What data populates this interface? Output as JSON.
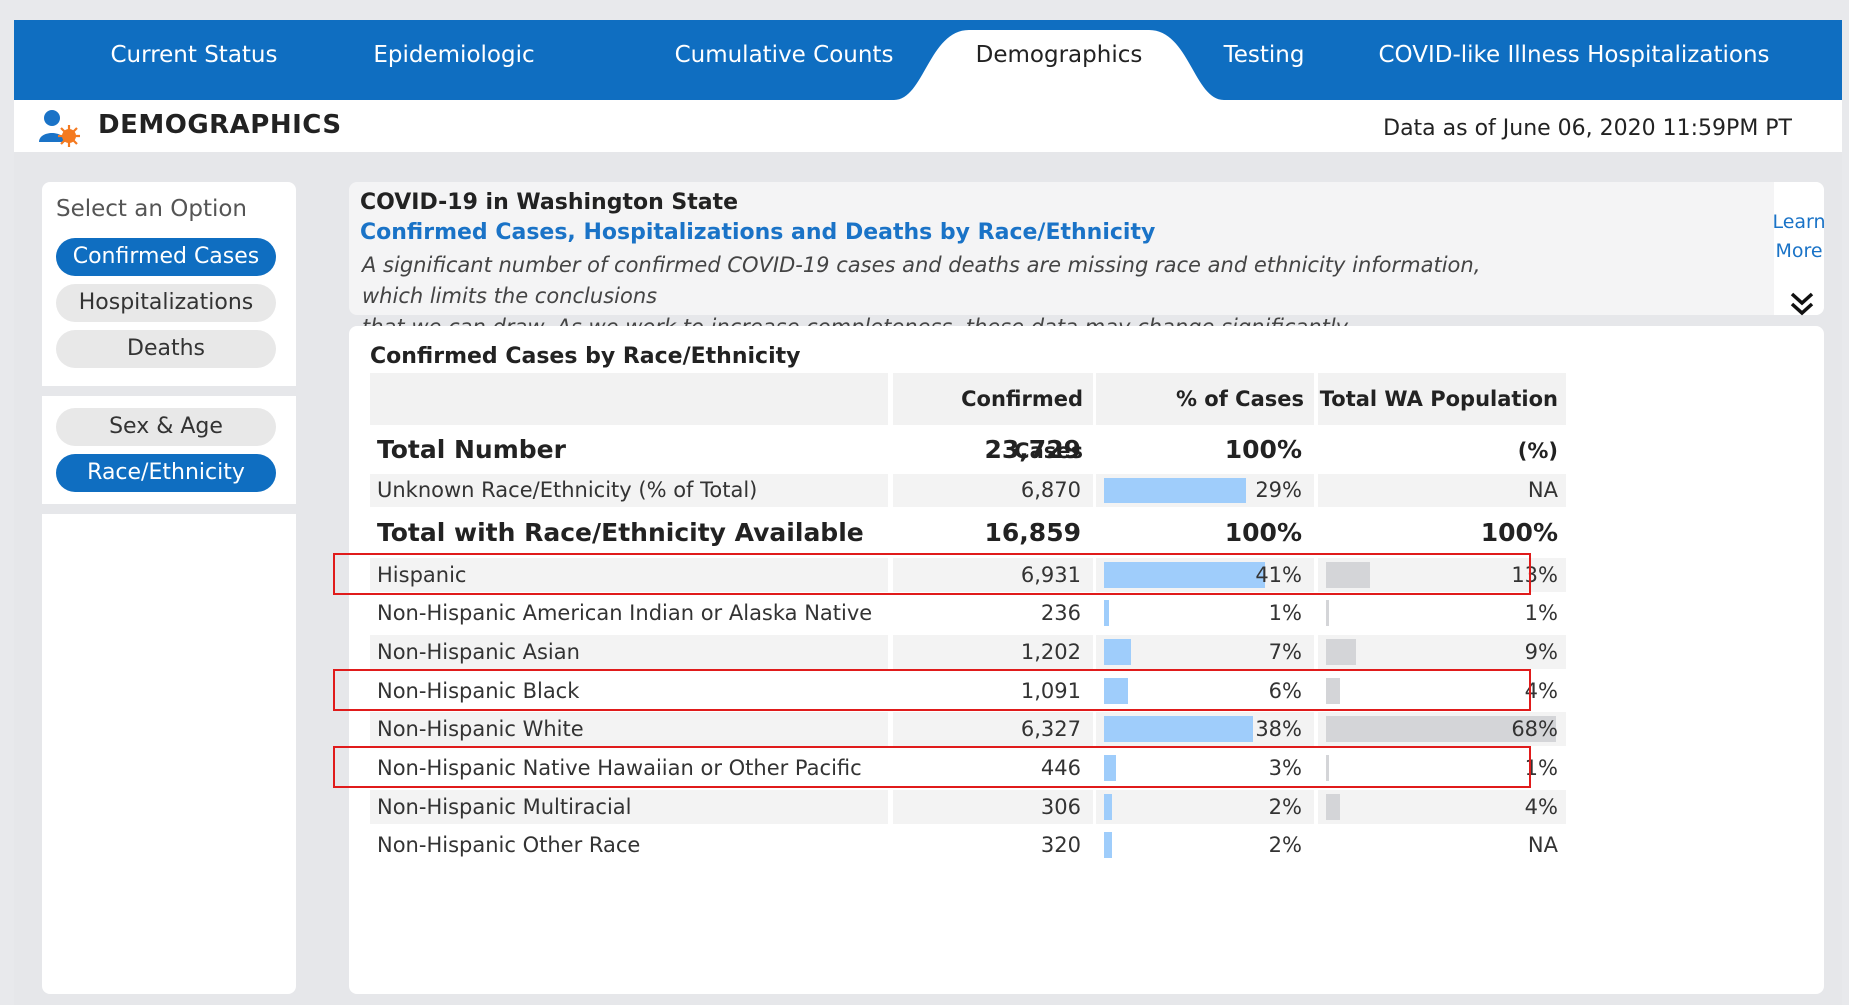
{
  "tabs": [
    {
      "label": "Current Status",
      "active": false
    },
    {
      "label": "Epidemiologic",
      "active": false
    },
    {
      "label": "Cumulative Counts",
      "active": false
    },
    {
      "label": "Demographics",
      "active": true
    },
    {
      "label": "Testing",
      "active": false
    },
    {
      "label": "COVID-like Illness Hospitalizations",
      "active": false
    }
  ],
  "header": {
    "icon": "user-virus-icon",
    "title": "DEMOGRAPHICS",
    "data_as_of": "Data as of June 06, 2020 11:59PM PT"
  },
  "sidebar": {
    "label": "Select an Option",
    "metric_options": [
      {
        "label": "Confirmed Cases",
        "active": true
      },
      {
        "label": "Hospitalizations",
        "active": false
      },
      {
        "label": "Deaths",
        "active": false
      }
    ],
    "view_options": [
      {
        "label": "Sex & Age",
        "active": false
      },
      {
        "label": "Race/Ethnicity",
        "active": true
      }
    ]
  },
  "info": {
    "title": "COVID-19 in Washington State",
    "subtitle": "Confirmed Cases, Hospitalizations and Deaths by Race/Ethnicity",
    "note_line1": "A significant number of confirmed COVID-19 cases and deaths are missing race and ethnicity information, which limits the conclusions",
    "note_line2": "that we can draw. As we work to increase completeness, these data may change significantly.",
    "learn_more_line1": "Learn",
    "learn_more_line2": "More",
    "expand_icon": "double-chevron-down-icon"
  },
  "table": {
    "title": "Confirmed Cases by Race/Ethnicity",
    "headers": {
      "cases": "Confirmed Cases",
      "pct_cases": "% of Cases",
      "population": "Total WA Population (%)"
    },
    "total_number": {
      "label": "Total Number",
      "cases": "23,729",
      "pct": "100%"
    },
    "unknown": {
      "label": "Unknown Race/Ethnicity (% of Total)",
      "cases": "6,870",
      "pct": "29%",
      "pct_value": 29,
      "population": "NA"
    },
    "total_available": {
      "label": "Total with Race/Ethnicity Available",
      "cases": "16,859",
      "pct": "100%",
      "population": "100%"
    },
    "rows": [
      {
        "label": "Hispanic",
        "cases": "6,931",
        "pct": "41%",
        "pct_value": 41,
        "population": "13%",
        "pop_value": 13,
        "highlighted": true
      },
      {
        "label": "Non-Hispanic American Indian or Alaska Native",
        "cases": "236",
        "pct": "1%",
        "pct_value": 1,
        "population": "1%",
        "pop_value": 1,
        "highlighted": false
      },
      {
        "label": "Non-Hispanic Asian",
        "cases": "1,202",
        "pct": "7%",
        "pct_value": 7,
        "population": "9%",
        "pop_value": 9,
        "highlighted": false
      },
      {
        "label": "Non-Hispanic Black",
        "cases": "1,091",
        "pct": "6%",
        "pct_value": 6,
        "population": "4%",
        "pop_value": 4,
        "highlighted": true
      },
      {
        "label": "Non-Hispanic White",
        "cases": "6,327",
        "pct": "38%",
        "pct_value": 38,
        "population": "68%",
        "pop_value": 68,
        "highlighted": false
      },
      {
        "label": "Non-Hispanic Native Hawaiian or Other Pacific Islander",
        "cases": "446",
        "pct": "3%",
        "pct_value": 3,
        "population": "1%",
        "pop_value": 1,
        "highlighted": true
      },
      {
        "label": "Non-Hispanic Multiracial",
        "cases": "306",
        "pct": "2%",
        "pct_value": 2,
        "population": "4%",
        "pop_value": 4,
        "highlighted": false
      },
      {
        "label": "Non-Hispanic Other Race",
        "cases": "320",
        "pct": "2%",
        "pct_value": 2,
        "population": "NA",
        "pop_value": null,
        "highlighted": false
      }
    ]
  },
  "colors": {
    "brand_blue": "#0f6ec1",
    "case_bar": "#9fcdfb",
    "population_bar": "#d4d5d8",
    "highlight_border": "#e01b1b"
  }
}
